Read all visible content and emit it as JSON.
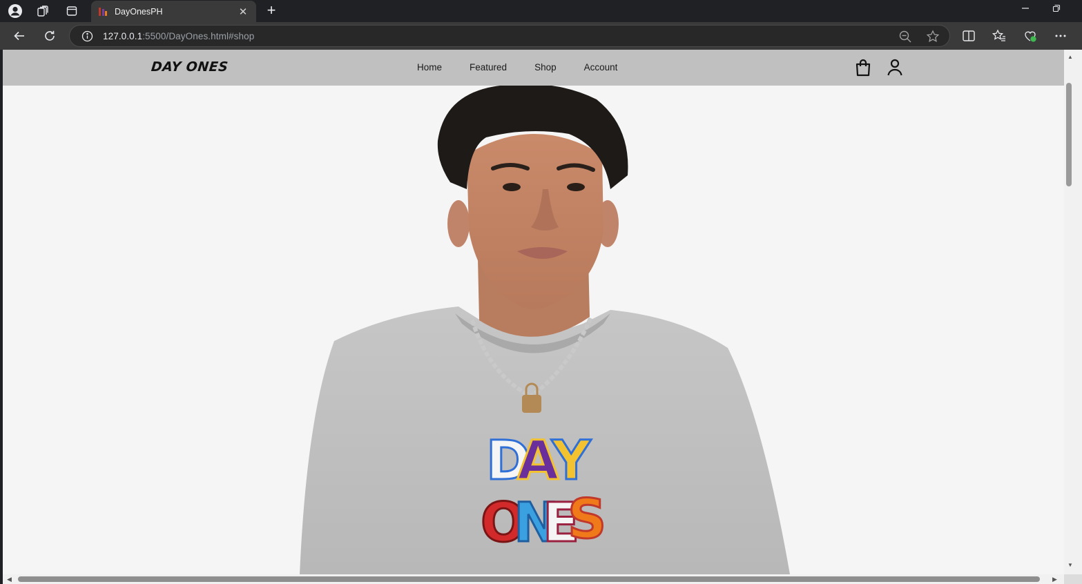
{
  "browser": {
    "tab_title": "DayOnesPH",
    "url_host": "127.0.0.1",
    "url_rest": ":5500/DayOnes.html#shop",
    "new_tab_label": "+",
    "close_tab_label": "✕"
  },
  "site": {
    "logo": "DAY ONES",
    "nav": [
      {
        "label": "Home"
      },
      {
        "label": "Featured"
      },
      {
        "label": "Shop"
      },
      {
        "label": "Account"
      }
    ],
    "icons": {
      "cart": "shopping-bag-icon",
      "account": "user-icon"
    }
  },
  "hero": {
    "shirt_text_top": "DAY",
    "shirt_text_bottom": "ONES",
    "shirt_colors": [
      "#f5f5f5",
      "#6a2f9a",
      "#2f6fd6",
      "#d22a2a",
      "#3aa0e0",
      "#f07a1a"
    ]
  }
}
